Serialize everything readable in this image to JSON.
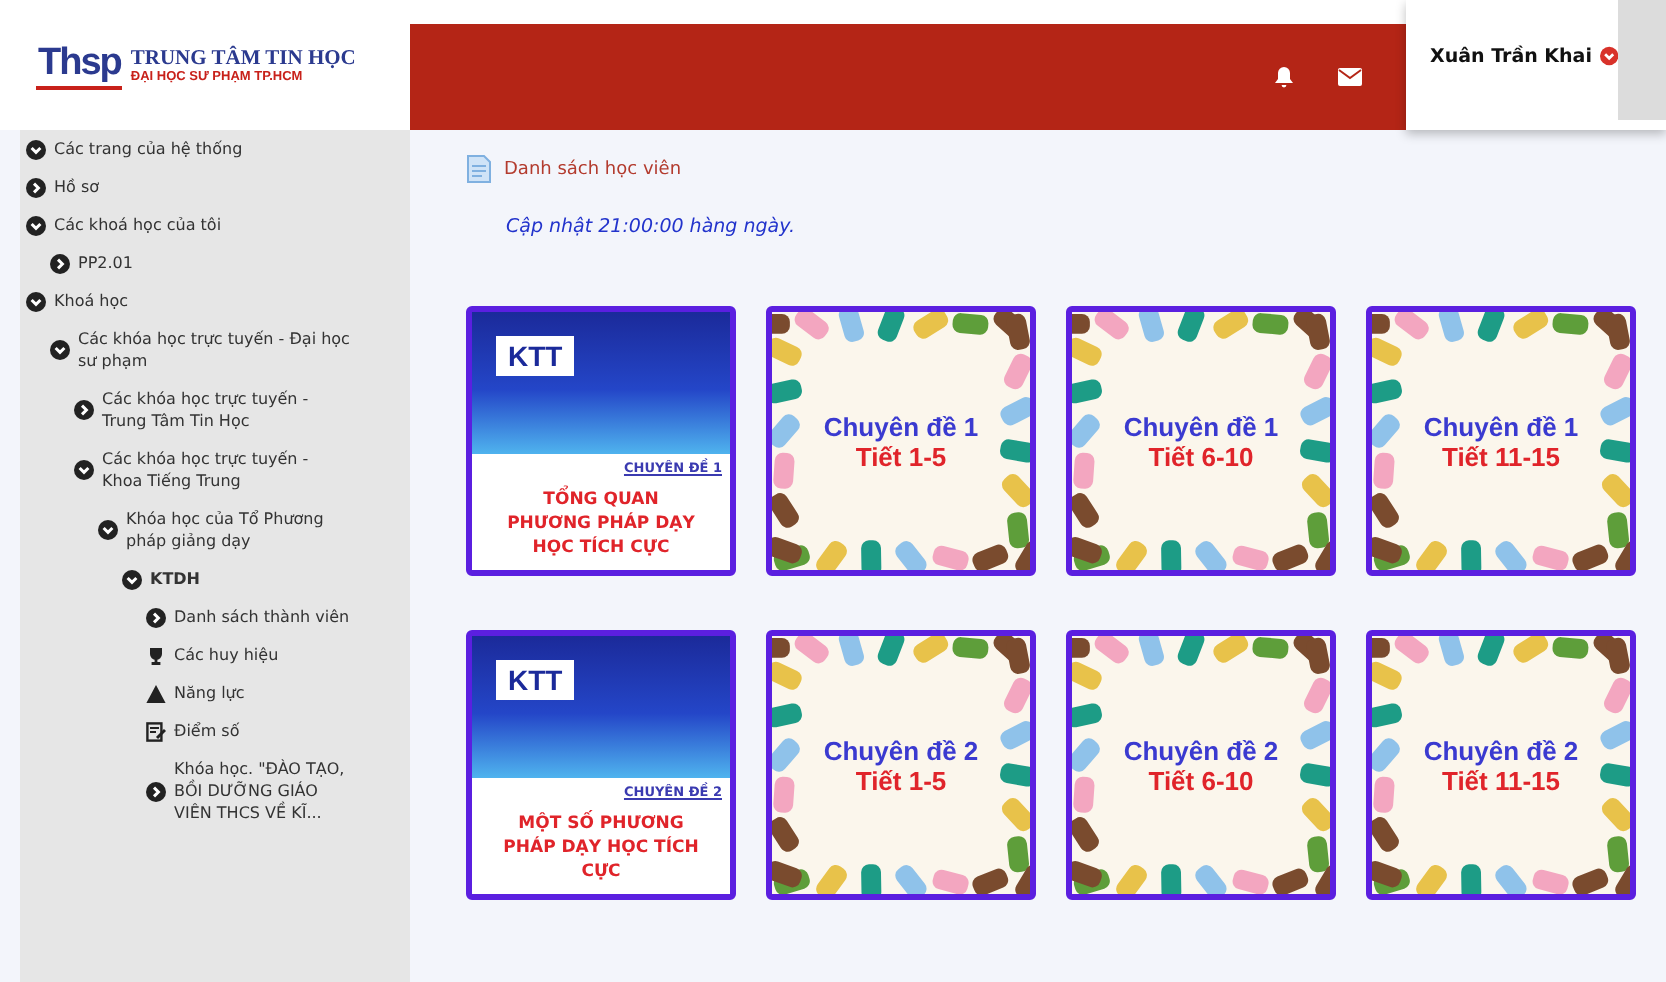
{
  "logo": {
    "mark": "Thsp",
    "title": "TRUNG TÂM TIN HỌC",
    "subtitle": "ĐẠI HỌC SƯ PHẠM TP.HCM"
  },
  "user": {
    "name": "Xuân Trần Khai"
  },
  "sidebar": {
    "items": [
      {
        "label": "Các trang của hệ thống",
        "kind": "node",
        "expanded": true,
        "selected": false
      },
      {
        "label": "Hồ sơ",
        "kind": "node",
        "expanded": false,
        "selected": false
      },
      {
        "label": "Các khoá học của tôi",
        "kind": "node",
        "expanded": true,
        "selected": false,
        "children": [
          {
            "label": "PP2.01",
            "kind": "node",
            "expanded": false,
            "selected": false
          }
        ]
      },
      {
        "label": "Khoá học",
        "kind": "node",
        "expanded": true,
        "selected": false,
        "children": [
          {
            "label": "Các khóa học trực tuyến - Đại học sư phạm",
            "kind": "node",
            "expanded": true,
            "selected": false,
            "children": [
              {
                "label": "Các khóa học trực tuyến - Trung Tâm Tin Học",
                "kind": "node",
                "expanded": false,
                "selected": false
              },
              {
                "label": "Các khóa học trực tuyến - Khoa Tiếng Trung",
                "kind": "node",
                "expanded": true,
                "selected": false,
                "children": [
                  {
                    "label": "Khóa học của Tổ Phương pháp giảng dạy",
                    "kind": "node",
                    "expanded": true,
                    "selected": false,
                    "children": [
                      {
                        "label": "KTDH",
                        "kind": "node",
                        "expanded": true,
                        "selected": true,
                        "children": [
                          {
                            "label": "Danh sách thành viên",
                            "kind": "node",
                            "expanded": false,
                            "selected": false
                          },
                          {
                            "label": "Các huy hiệu",
                            "kind": "trophy",
                            "selected": false
                          },
                          {
                            "label": "Năng lực",
                            "kind": "triangle",
                            "selected": false
                          },
                          {
                            "label": "Điểm số",
                            "kind": "grades",
                            "selected": false
                          },
                          {
                            "label": "Khóa học. \"ĐÀO TẠO, BỒI DƯỠNG GIÁO VIÊN THCS VỀ KĨ...",
                            "kind": "node",
                            "expanded": false,
                            "selected": false
                          }
                        ]
                      }
                    ]
                  }
                ]
              }
            ]
          }
        ]
      }
    ]
  },
  "content": {
    "link": "Danh sách học viên",
    "note": "Cập nhật 21:00:00 hàng ngày.",
    "tiles": [
      {
        "kind": "cover",
        "logo": "KTT",
        "tag": "CHUYÊN ĐỀ 1",
        "title": "TỔNG QUAN PHƯƠNG PHÁP DẠY HỌC TÍCH CỰC"
      },
      {
        "kind": "illustration",
        "topic": "Chuyên đề 1",
        "period": "Tiết 1-5"
      },
      {
        "kind": "illustration",
        "topic": "Chuyên đề 1",
        "period": "Tiết 6-10"
      },
      {
        "kind": "illustration",
        "topic": "Chuyên đề 1",
        "period": "Tiết 11-15"
      },
      {
        "kind": "cover",
        "logo": "KTT",
        "tag": "CHUYÊN ĐỀ 2",
        "title": "MỘT SỐ PHƯƠNG PHÁP DẠY HỌC TÍCH CỰC"
      },
      {
        "kind": "illustration",
        "topic": "Chuyên đề 2",
        "period": "Tiết 1-5"
      },
      {
        "kind": "illustration",
        "topic": "Chuyên đề 2",
        "period": "Tiết 6-10"
      },
      {
        "kind": "illustration",
        "topic": "Chuyên đề 2",
        "period": "Tiết 11-15"
      }
    ]
  }
}
